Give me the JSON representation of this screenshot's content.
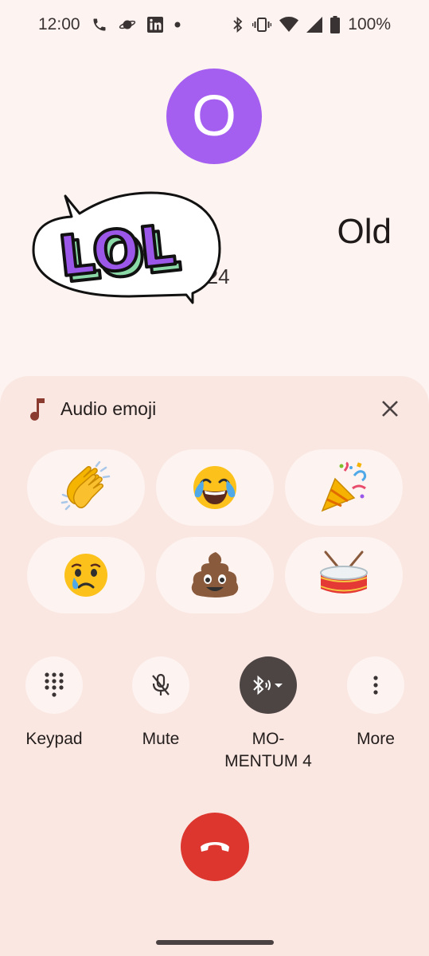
{
  "status_bar": {
    "time": "12:00",
    "battery": "100%",
    "left_icons": [
      "phone-icon",
      "planet-icon",
      "linkedin-icon",
      "dot-icon"
    ],
    "right_icons": [
      "bluetooth-icon",
      "vibrate-icon",
      "wifi-icon",
      "signal-icon",
      "battery-icon"
    ]
  },
  "caller": {
    "avatar_letter": "O",
    "avatar_color": "#a45ff0",
    "name": "Old",
    "timer": "0:24",
    "sticker_text": "LOL"
  },
  "audio_emoji": {
    "title": "Audio emoji",
    "emojis": [
      "clapping-hands",
      "tears-of-joy",
      "party-popper",
      "crying-face",
      "pile-of-poo",
      "drum"
    ]
  },
  "controls": {
    "keypad_label": "Keypad",
    "mute_label": "Mute",
    "audio_route_label": "MO-\nMENTUM 4",
    "more_label": "More"
  },
  "colors": {
    "background": "#fdf3f0",
    "sheet": "#fae7e2",
    "end_call": "#dc362e",
    "active_control": "#4d4444"
  }
}
